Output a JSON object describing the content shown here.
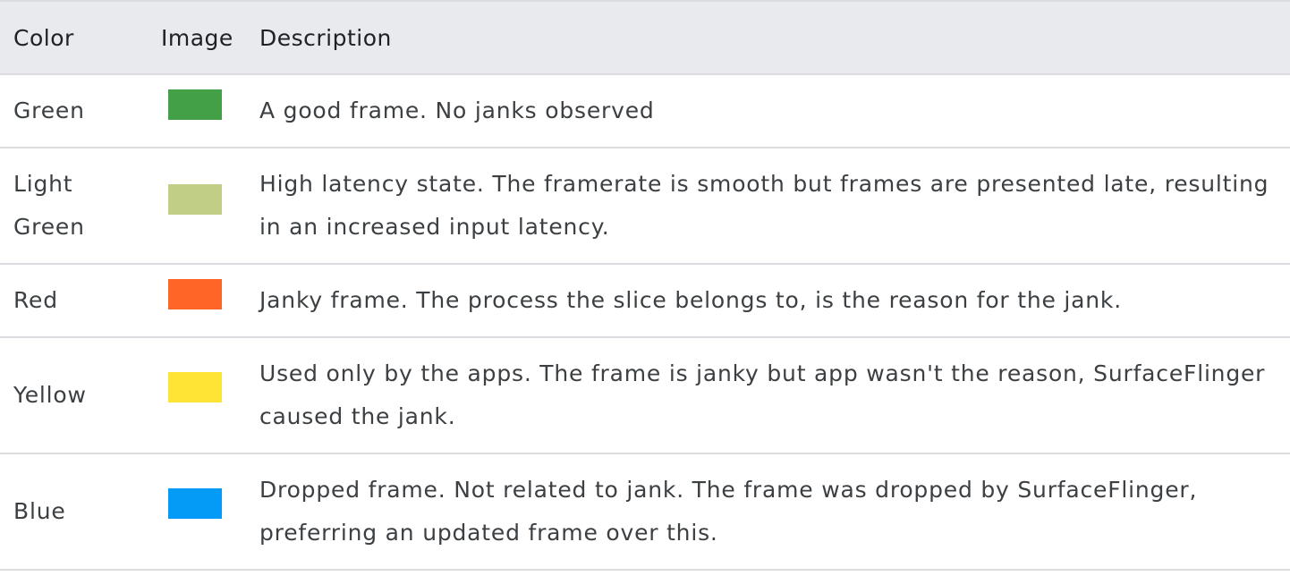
{
  "table": {
    "headers": {
      "color": "Color",
      "image": "Image",
      "description": "Description"
    },
    "rows": [
      {
        "color_name": "Green",
        "swatch_color": "#43a047",
        "description": "A good frame. No janks observed"
      },
      {
        "color_name": "Light Green",
        "swatch_color": "#c0ce86",
        "description": "High latency state. The framerate is smooth but frames are presented late, resulting in an increased input latency."
      },
      {
        "color_name": "Red",
        "swatch_color": "#ff6526",
        "description": "Janky frame. The process the slice belongs to, is the reason for the jank."
      },
      {
        "color_name": "Yellow",
        "swatch_color": "#ffe335",
        "description": "Used only by the apps. The frame is janky but app wasn't the reason, SurfaceFlinger caused the jank."
      },
      {
        "color_name": "Blue",
        "swatch_color": "#039bf5",
        "description": "Dropped frame. Not related to jank. The frame was dropped by SurfaceFlinger, preferring an updated frame over this."
      }
    ]
  }
}
